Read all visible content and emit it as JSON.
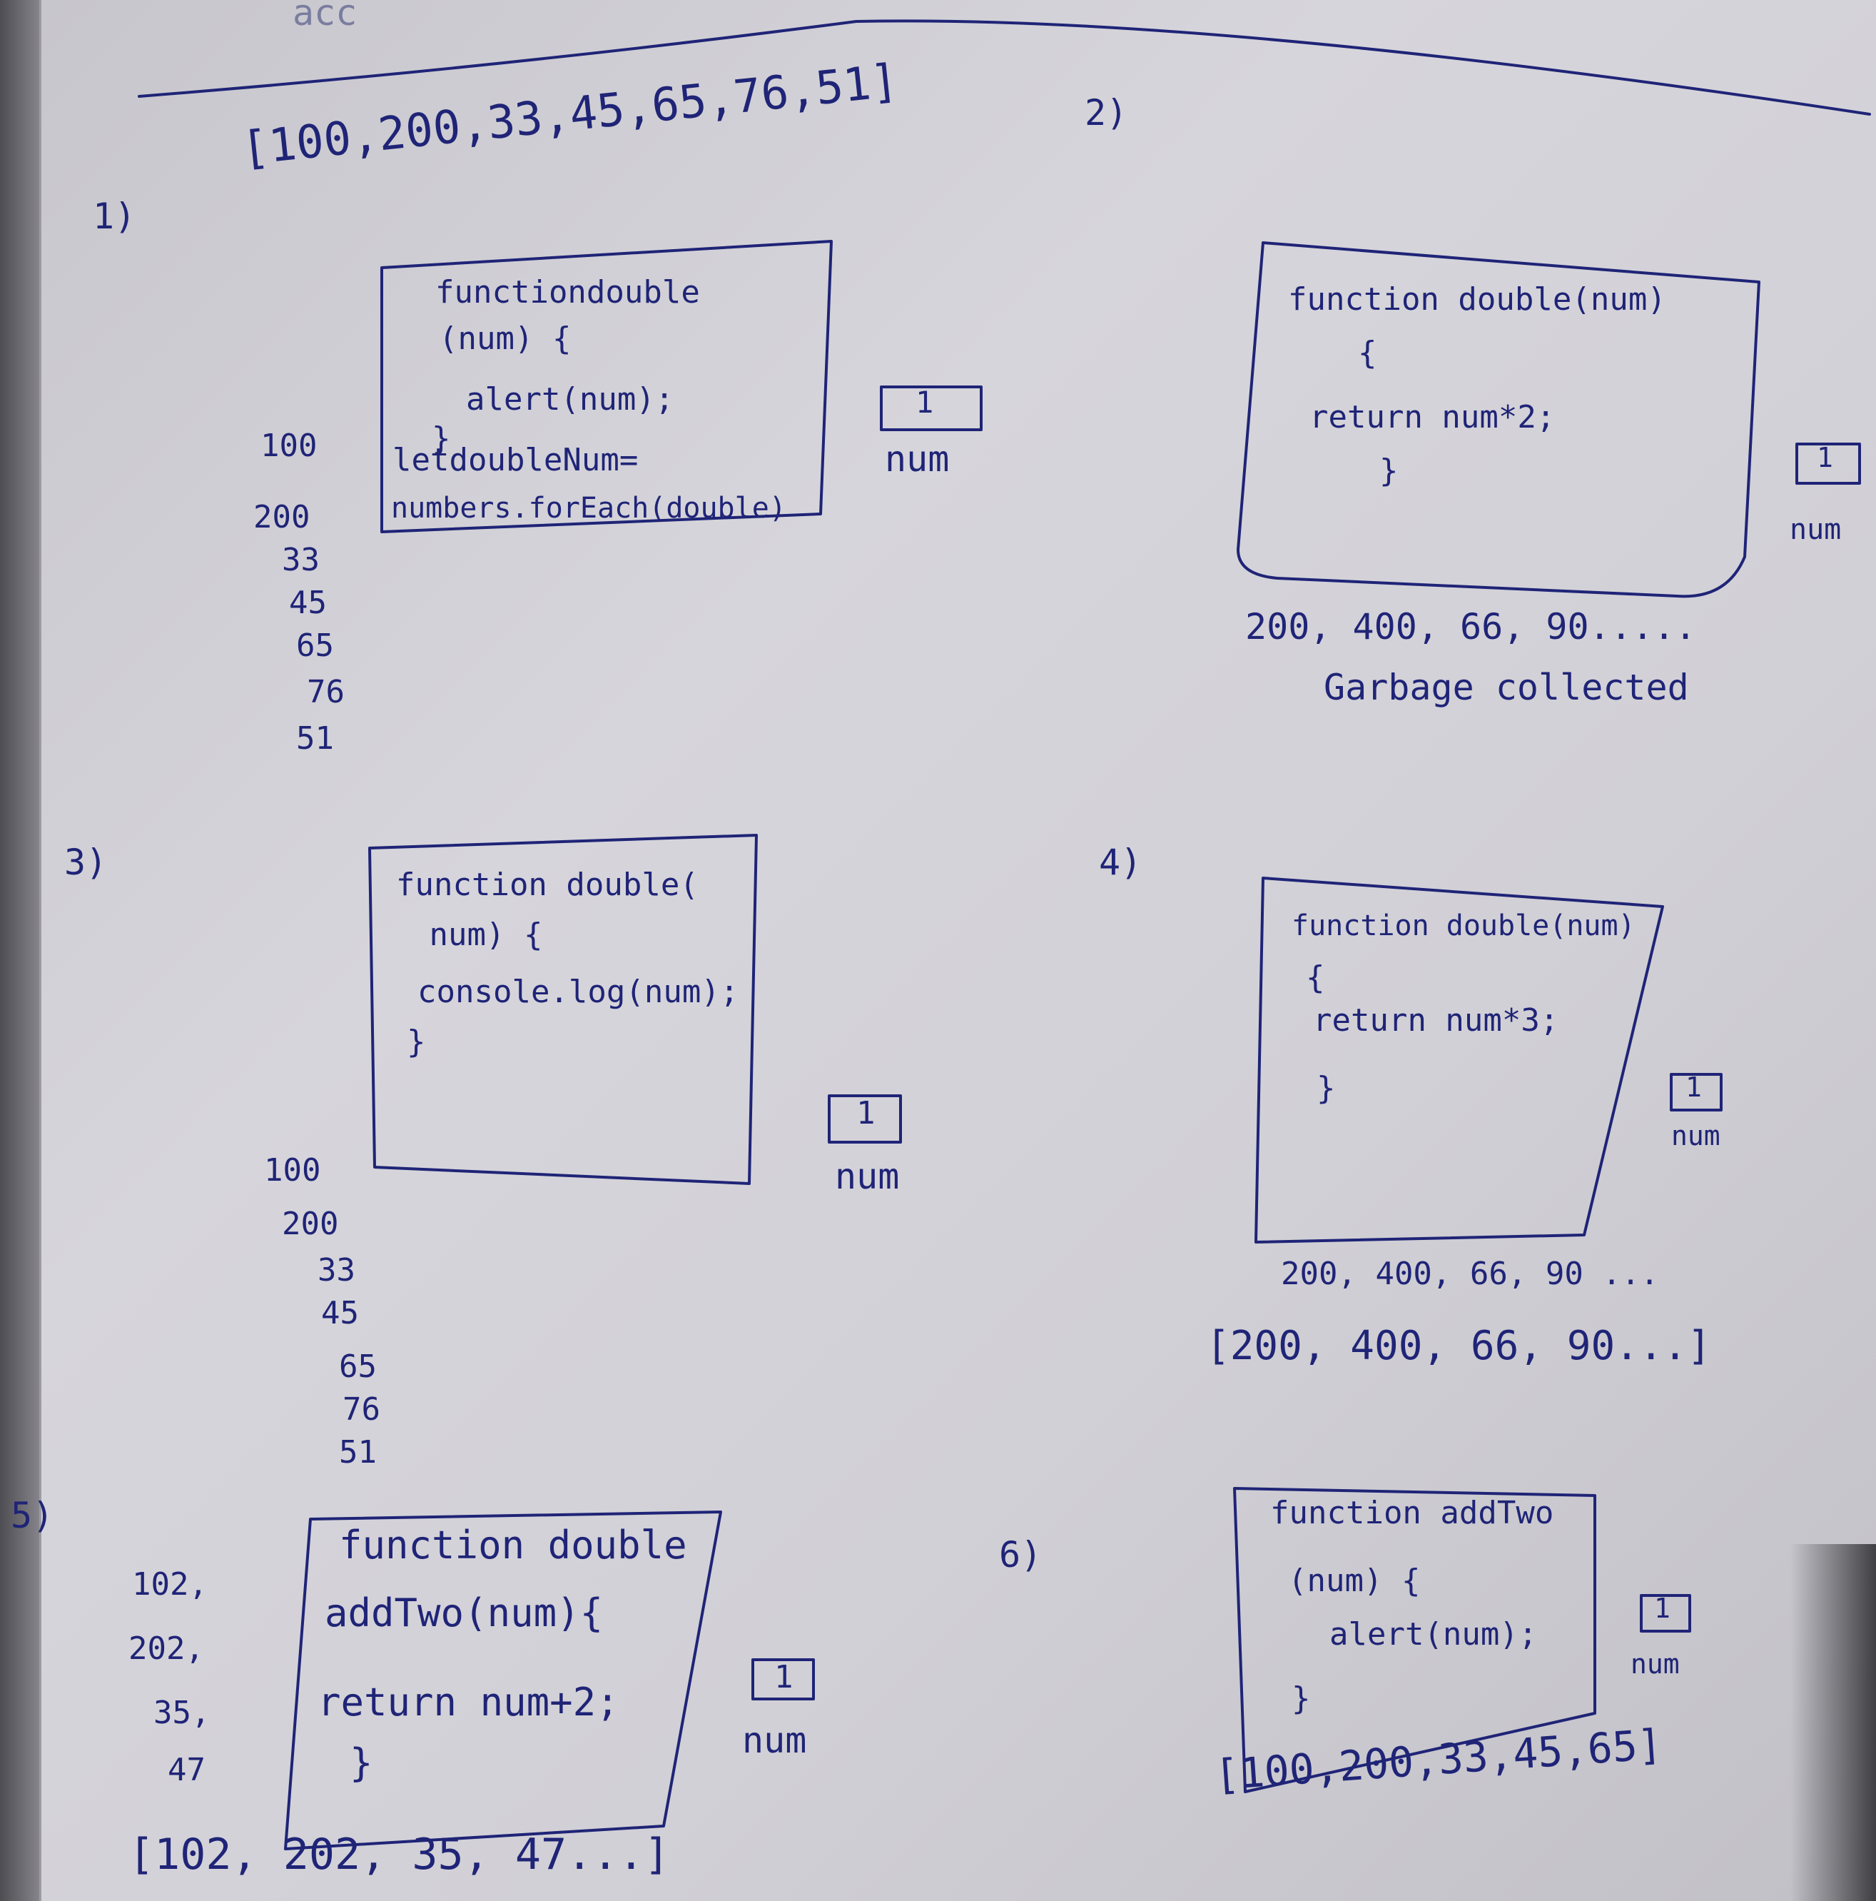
{
  "header_scrap": "acc",
  "top_array": "[100,200,33,45,65,76,51]",
  "panels": [
    {
      "number": "1)",
      "code_lines": [
        "functiondouble",
        "(num) {",
        "  alert(num);",
        "}",
        "letdoubleNum=",
        "numbers.forEach(double)"
      ],
      "values": [
        "100",
        "200",
        "33",
        "45",
        "65",
        "76",
        "51"
      ],
      "num_box": "1",
      "num_label": "num"
    },
    {
      "number": "2)",
      "code_lines": [
        "function double(num)",
        "  {",
        "return num*2;",
        "  }"
      ],
      "num_box": "1",
      "num_label": "num",
      "result": "200, 400, 66, 90.....",
      "note": "Garbage collected"
    },
    {
      "number": "3)",
      "code_lines": [
        "function double(",
        " num) {",
        "console.log(num);",
        "}"
      ],
      "values": [
        "100",
        "200",
        "33",
        "45",
        "65",
        "76",
        "51"
      ],
      "num_box": "1",
      "num_label": "num"
    },
    {
      "number": "4)",
      "code_lines": [
        "function double(num)",
        "{",
        "return num*3;",
        "}"
      ],
      "num_box": "1",
      "num_label": "num",
      "result": "200, 400, 66, 90 ...",
      "result_array": "[200, 400, 66, 90...]"
    },
    {
      "number": "5)",
      "code_lines": [
        "function double",
        "addTwo(num){",
        "return num+2;",
        "}"
      ],
      "values": [
        "102,",
        "202,",
        "35,",
        "47"
      ],
      "num_box": "1",
      "num_label": "num",
      "result_array": "[102, 202, 35, 47...]"
    },
    {
      "number": "6)",
      "code_lines": [
        "function addTwo",
        "(num) {",
        "  alert(num);",
        "}"
      ],
      "num_box": "1",
      "num_label": "num",
      "result_array": "[100,200,33,45,65]"
    }
  ]
}
